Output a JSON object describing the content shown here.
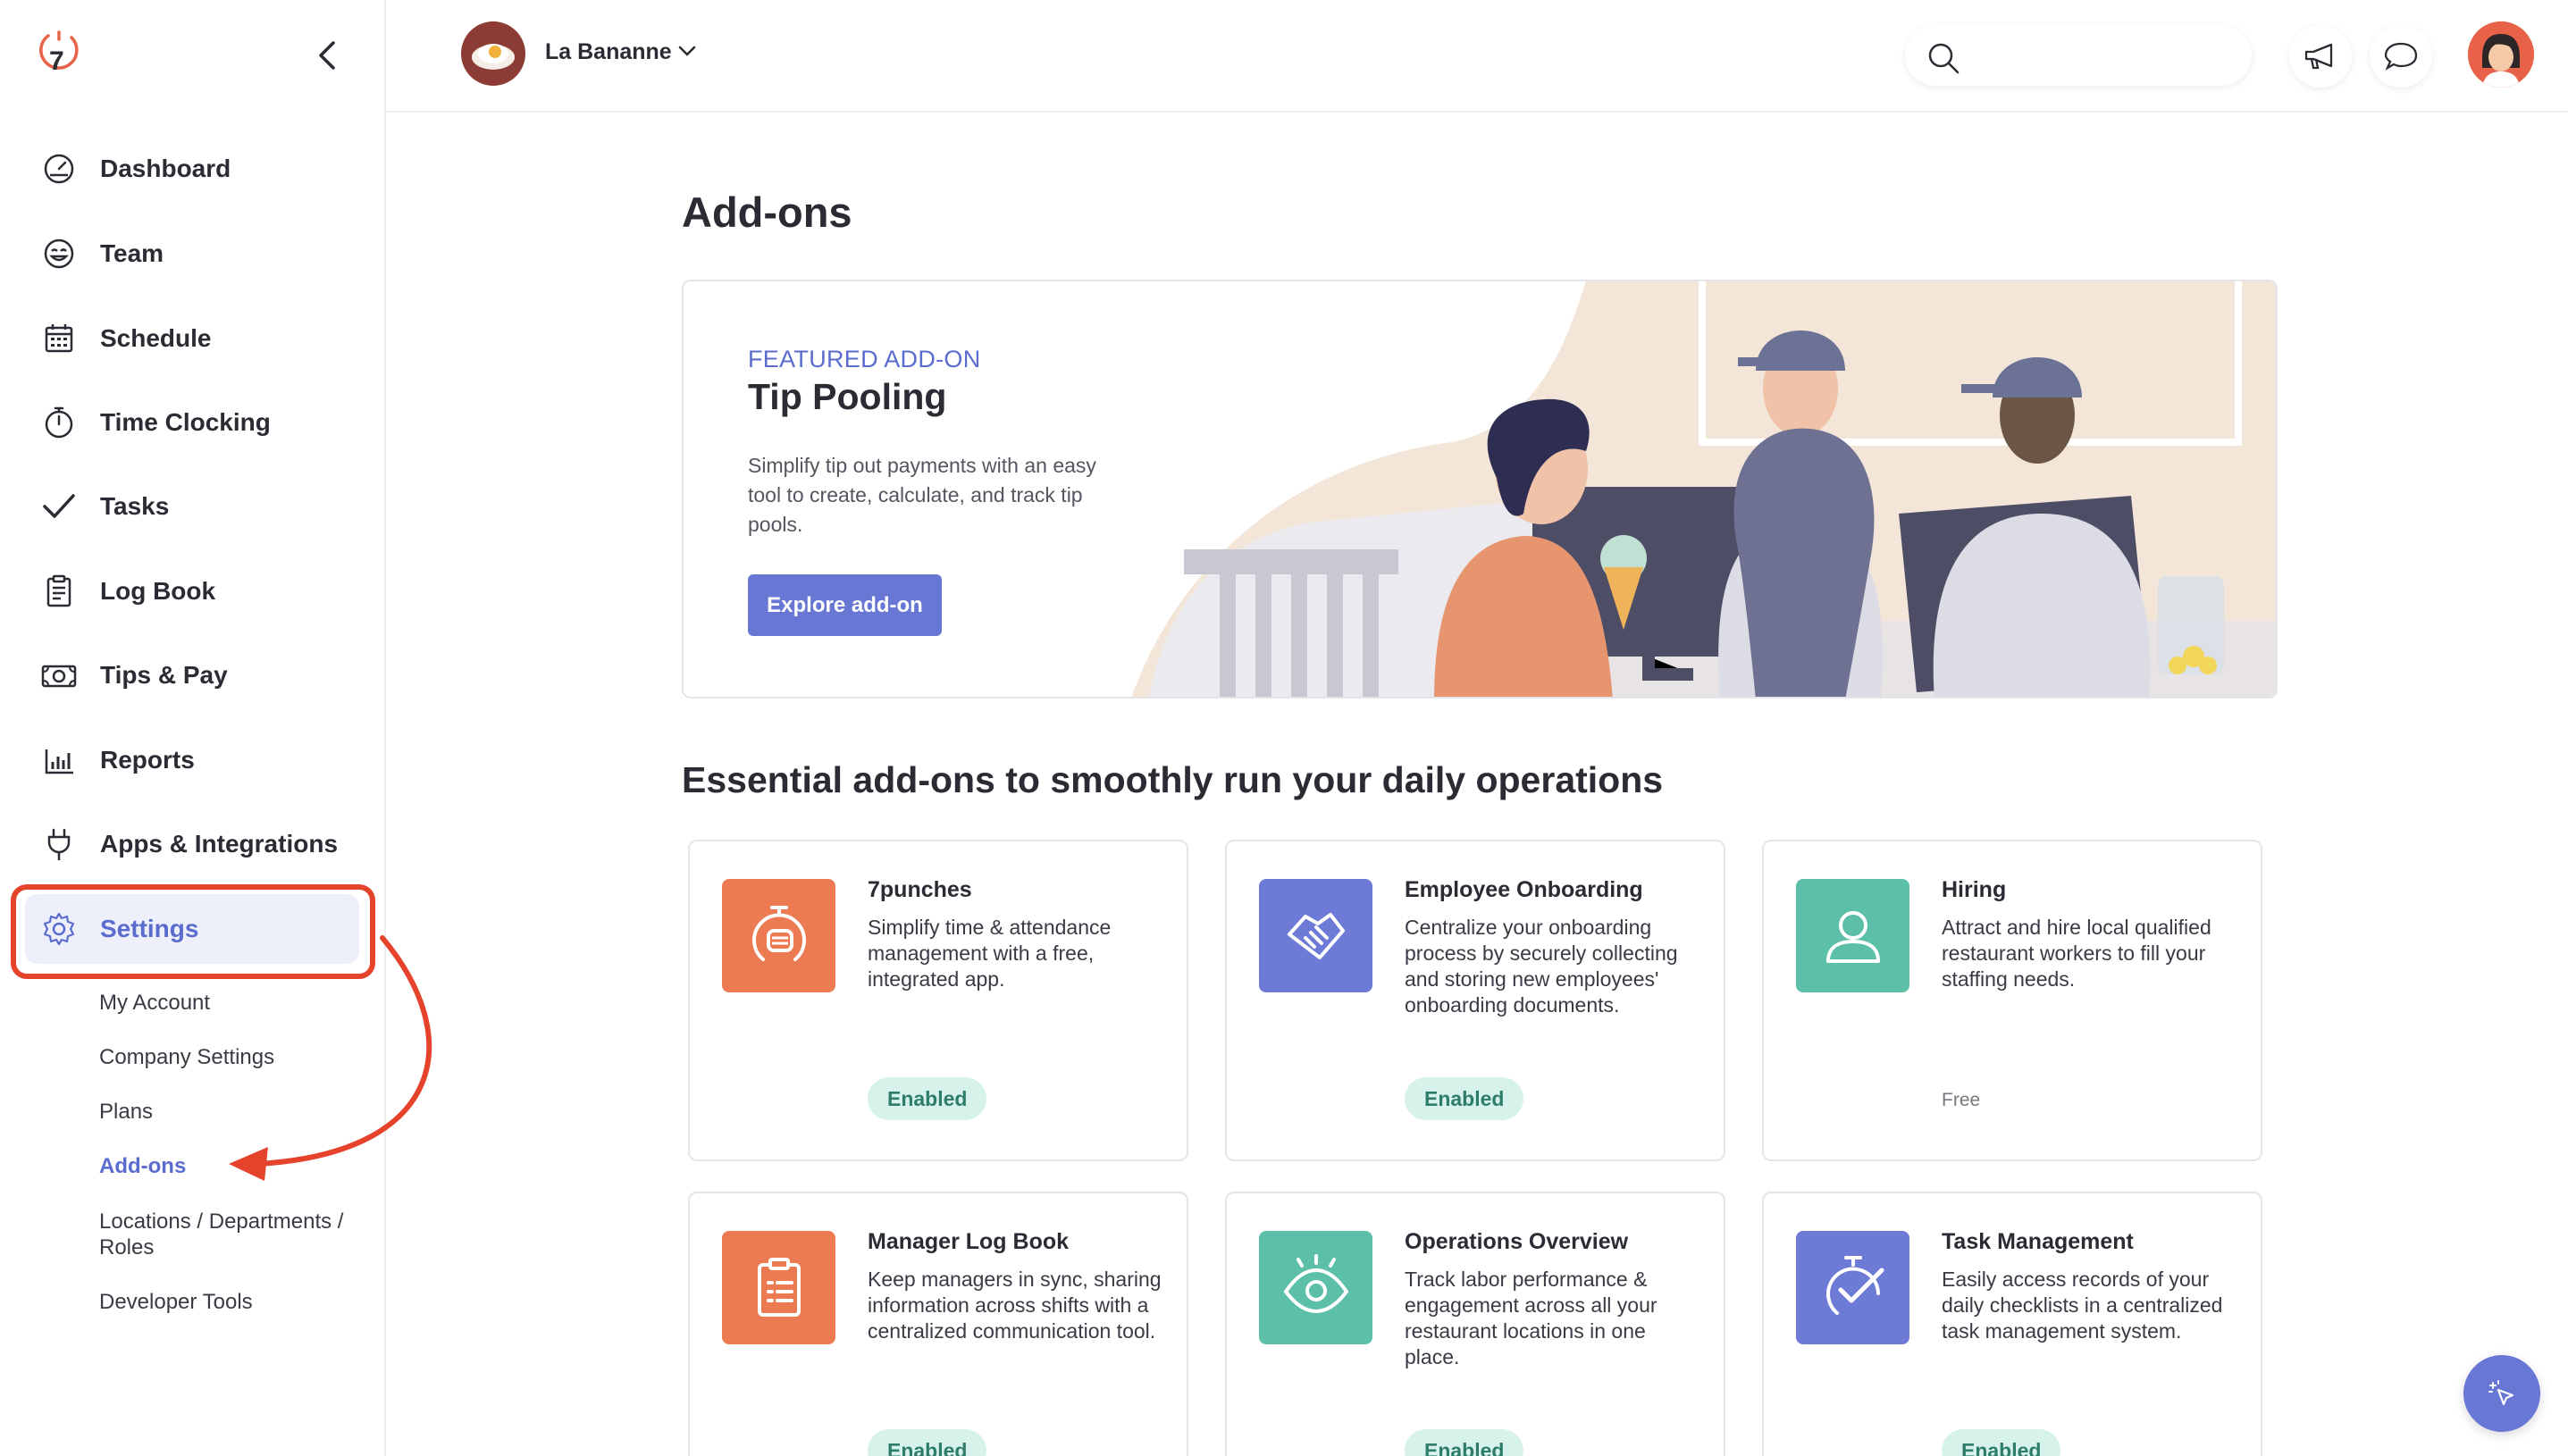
{
  "app": {
    "company_name": "La Bananne",
    "accent_color": "#6877d3",
    "annotation_color": "#e5432c"
  },
  "sidebar": {
    "items": [
      {
        "label": "Dashboard",
        "icon": "dashboard-icon"
      },
      {
        "label": "Team",
        "icon": "smiley-icon"
      },
      {
        "label": "Schedule",
        "icon": "calendar-icon"
      },
      {
        "label": "Time Clocking",
        "icon": "stopwatch-icon"
      },
      {
        "label": "Tasks",
        "icon": "checkmark-icon"
      },
      {
        "label": "Log Book",
        "icon": "clipboard-icon"
      },
      {
        "label": "Tips & Pay",
        "icon": "money-icon"
      },
      {
        "label": "Reports",
        "icon": "bar-chart-icon"
      },
      {
        "label": "Apps & Integrations",
        "icon": "plug-icon"
      },
      {
        "label": "Settings",
        "icon": "gear-icon"
      }
    ],
    "settings_sub": [
      "My Account",
      "Company Settings",
      "Plans",
      "Add-ons",
      "Locations / Departments / Roles",
      "Developer Tools"
    ]
  },
  "topbar": {
    "search_placeholder": ""
  },
  "main": {
    "title": "Add-ons",
    "featured": {
      "kicker": "FEATURED ADD-ON",
      "title": "Tip Pooling",
      "description": "Simplify tip out payments with an easy tool to create, calculate, and track tip pools.",
      "button": "Explore add-on"
    },
    "section_title": "Essential add-ons to smoothly run your daily operations",
    "cards": [
      {
        "title": "7punches",
        "description": "Simplify time & attendance management with a free, integrated app.",
        "status": "Enabled",
        "icon": "fist-clock-icon",
        "color": "#ec7a52"
      },
      {
        "title": "Employee Onboarding",
        "description": "Centralize your onboarding process by securely collecting and storing new employees' onboarding documents.",
        "status": "Enabled",
        "icon": "handshake-icon",
        "color": "#6e7bd6"
      },
      {
        "title": "Hiring",
        "description": "Attract and hire local qualified restaurant workers to fill your staffing needs.",
        "price": "Free",
        "icon": "person-icon",
        "color": "#5cbfa8"
      },
      {
        "title": "Manager Log Book",
        "description": "Keep managers in sync, sharing information across shifts with a centralized communication tool.",
        "status": "Enabled",
        "icon": "clipboard-icon",
        "color": "#ec7a52"
      },
      {
        "title": "Operations Overview",
        "description": "Track labor performance & engagement across all your restaurant locations in one place.",
        "status": "Enabled",
        "icon": "eye-icon",
        "color": "#5cbfa8"
      },
      {
        "title": "Task Management",
        "description": "Easily access records of your daily checklists in a centralized task management system.",
        "status": "Enabled",
        "icon": "checklist-timer-icon",
        "color": "#6e7bd6"
      }
    ]
  }
}
